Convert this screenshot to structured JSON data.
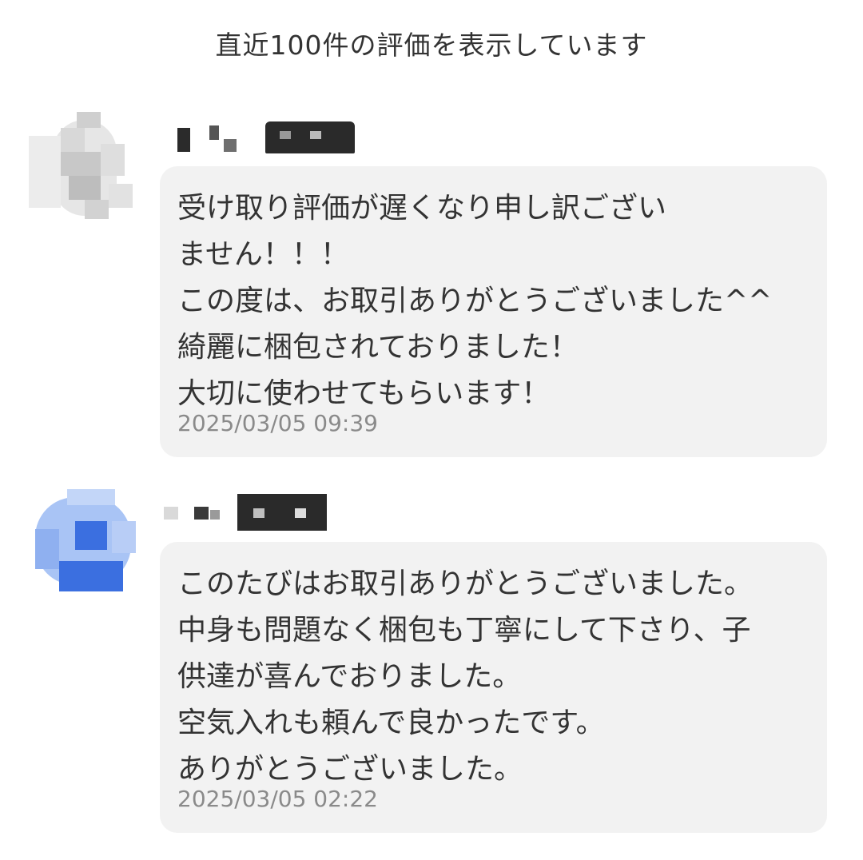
{
  "header": {
    "title": "直近100件の評価を表示しています"
  },
  "reviews": [
    {
      "comment": "受け取り評価が遅くなり申し訳ござい\nません！！！\nこの度は、お取引ありがとうございました^^\n綺麗に梱包されておりました！\n大切に使わせてもらいます！",
      "date": "2025/03/05 09:39"
    },
    {
      "comment": "このたびはお取引ありがとうございました。\n中身も問題なく梱包も丁寧にして下さり、子\n供達が喜んでおりました。\n空気入れも頼んで良かったです。\nありがとうございました。",
      "date": "2025/03/05 02:22"
    }
  ],
  "colors": {
    "bubble_background": "#f2f2f2",
    "text": "#333333",
    "timestamp": "#8a8a8a",
    "avatar_2_accent": "#3b6fe0"
  },
  "icons": {
    "avatar_1": "pixelated-avatar-icon",
    "avatar_2": "pixelated-avatar-icon"
  }
}
